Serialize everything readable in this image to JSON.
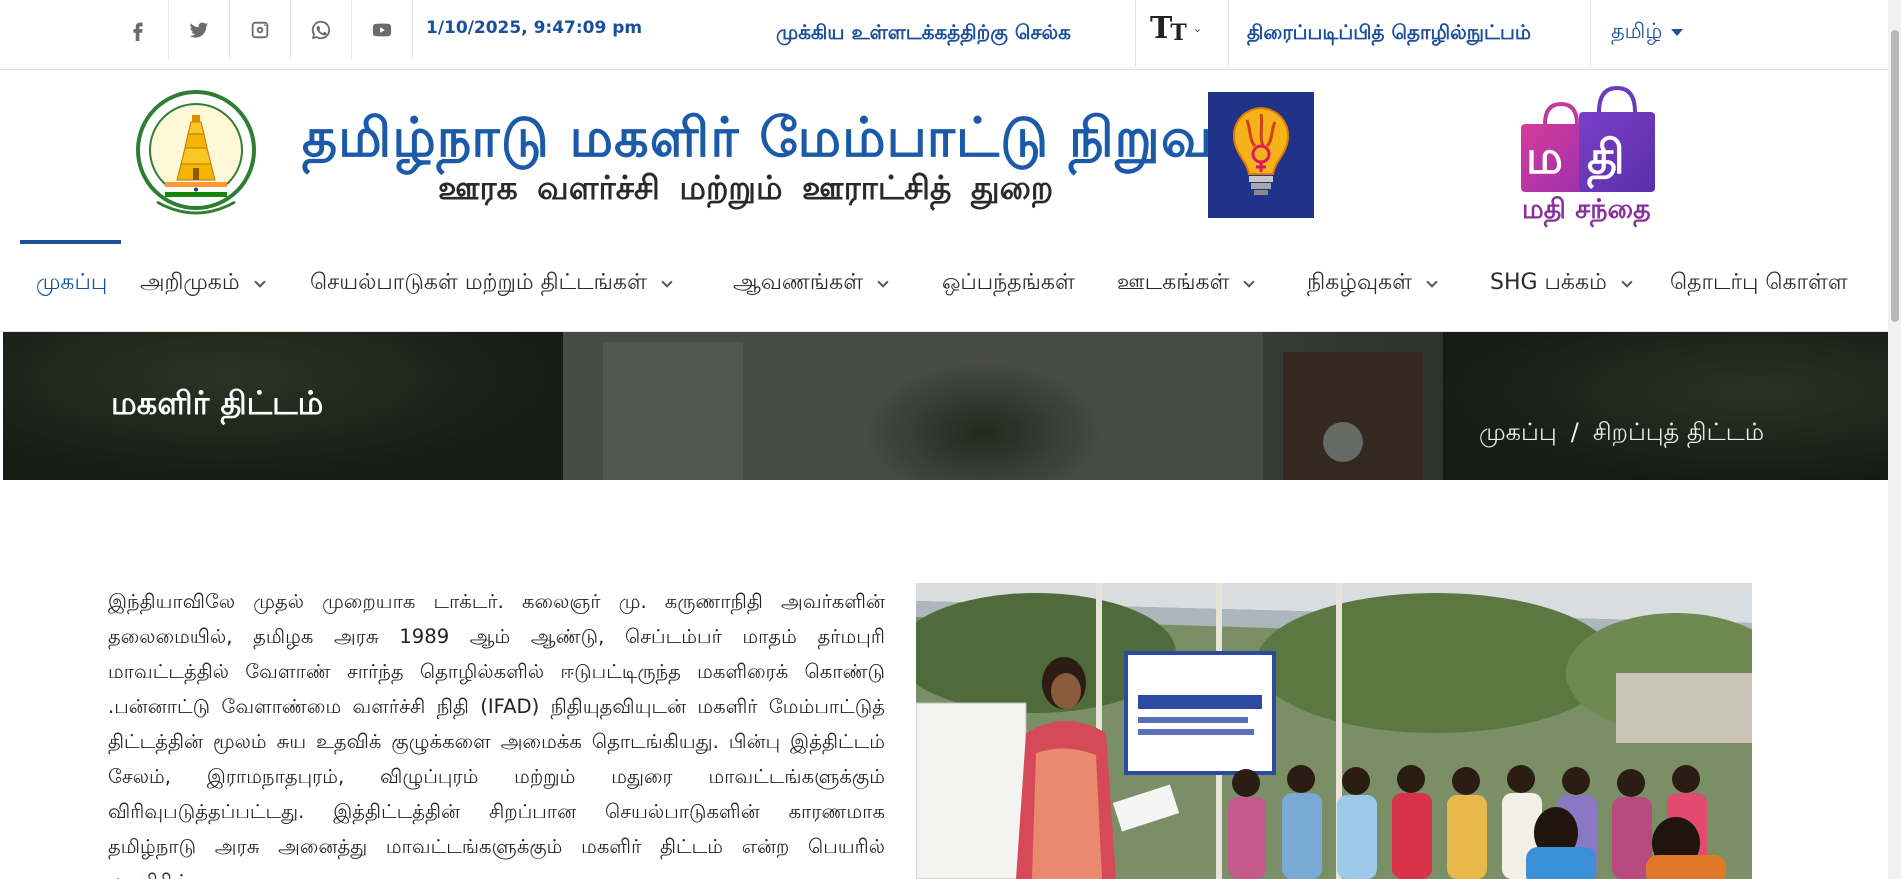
{
  "topbar": {
    "social": [
      {
        "name": "facebook-icon"
      },
      {
        "name": "twitter-icon"
      },
      {
        "name": "instagram-icon"
      },
      {
        "name": "whatsapp-icon"
      },
      {
        "name": "youtube-icon"
      }
    ],
    "datetime": "1/10/2025, 9:47:09 pm",
    "skip_to_content": "முக்கிய உள்ளடக்கத்திற்கு செல்க",
    "font_size_control": "TT",
    "screen_reader": "திரைப்படிப்பித் தொழில்நுட்பம்",
    "language": "தமிழ்"
  },
  "header": {
    "title": "தமிழ்நாடு மகளிர் மேம்பாட்டு நிறுவனம்",
    "subtitle": "ஊரக வளர்ச்சி மற்றும் ஊராட்சித் துறை",
    "mathi_label": "மதி சந்தை",
    "mathi_badge": "ம தி"
  },
  "nav": {
    "items": [
      {
        "label": "முகப்பு",
        "dropdown": false
      },
      {
        "label": "அறிமுகம்",
        "dropdown": true
      },
      {
        "label": "செயல்பாடுகள் மற்றும் திட்டங்கள்",
        "dropdown": true
      },
      {
        "label": "ஆவணங்கள்",
        "dropdown": true
      },
      {
        "label": "ஒப்பந்தங்கள்",
        "dropdown": false
      },
      {
        "label": "ஊடகங்கள்",
        "dropdown": true
      },
      {
        "label": "நிகழ்வுகள்",
        "dropdown": true
      },
      {
        "label": "SHG பக்கம்",
        "dropdown": true
      },
      {
        "label": "தொடர்பு கொள்ள",
        "dropdown": false
      }
    ]
  },
  "hero": {
    "title": "மகளிர் திட்டம்",
    "breadcrumb": [
      "முகப்பு",
      "சிறப்புத் திட்டம்"
    ],
    "breadcrumb_sep": "/"
  },
  "content": {
    "paragraph": "இந்தியாவிலே முதல் முறையாக டாக்டர். கலைஞர் மு. கருணாநிதி அவர்களின் தலைமையில், தமிழக அரசு 1989 ஆம் ஆண்டு, செப்டம்பர் மாதம் தர்மபுரி மாவட்டத்தில் வேளாண் சார்ந்த தொழில்களில் ஈடுபட்டிருந்த மகளிரைக் கொண்டு .பன்னாட்டு வேளாண்மை வளர்ச்சி நிதி (IFAD) நிதியுதவியுடன் மகளிர் மேம்பாட்டுத் திட்டத்தின் மூலம் சுய உதவிக் குழுக்களை அமைக்க தொடங்கியது. பின்பு இத்திட்டம் சேலம், இராமநாதபுரம், விழுப்புரம் மற்றும் மதுரை மாவட்டங்களுக்கும் விரிவுபடுத்தப்பட்டது. இத்திட்டத்தின் சிறப்பான செயல்பாடுகளின் காரணமாக தமிழ்நாடு அரசு அனைத்து மாவட்டங்களுக்கும் மகளிர் திட்டம் என்ற பெயரில் மகளிரின்"
  },
  "colors": {
    "primary_blue": "#1a4f9c",
    "title_blue": "#1a5aa8",
    "mathi_purple": "#8a2f9e"
  }
}
